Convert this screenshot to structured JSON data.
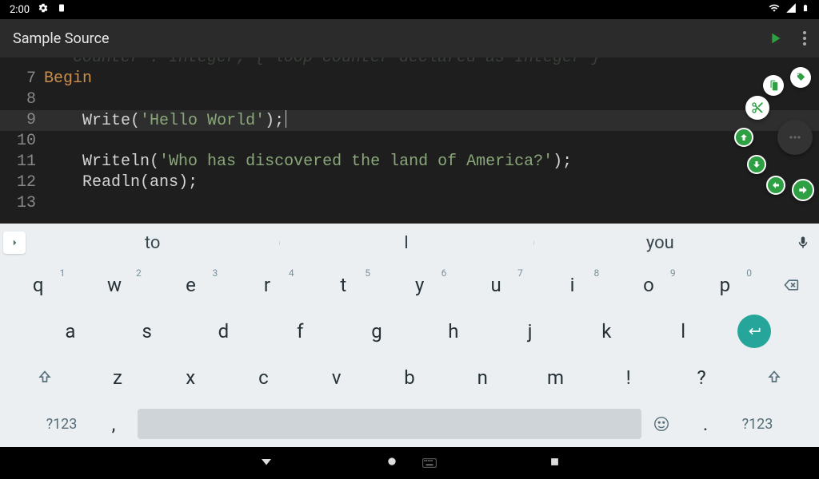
{
  "status": {
    "time": "2:00"
  },
  "app": {
    "title": "Sample Source"
  },
  "editor": {
    "visible_comment_fragment": "{ loop counter declared as Integer }",
    "lines": [
      {
        "n": "7",
        "kw": "Begin",
        "rest": ""
      },
      {
        "n": "8",
        "code": ""
      },
      {
        "n": "9",
        "fn": "Write",
        "open": "(",
        "str": "'Hello World'",
        "close": ");",
        "cursor": true
      },
      {
        "n": "10",
        "code": ""
      },
      {
        "n": "11",
        "fn": "Writeln",
        "open": "(",
        "str": "'Who has discovered the land of America?'",
        "close": ");"
      },
      {
        "n": "12",
        "fn": "Readln",
        "open": "(",
        "var": "ans",
        "close": ");"
      },
      {
        "n": "13",
        "code": ""
      }
    ]
  },
  "suggestions": {
    "s1": "to",
    "s2": "I",
    "s3": "you"
  },
  "keys": {
    "r1": [
      {
        "k": "q",
        "s": "1"
      },
      {
        "k": "w",
        "s": "2"
      },
      {
        "k": "e",
        "s": "3"
      },
      {
        "k": "r",
        "s": "4"
      },
      {
        "k": "t",
        "s": "5"
      },
      {
        "k": "y",
        "s": "6"
      },
      {
        "k": "u",
        "s": "7"
      },
      {
        "k": "i",
        "s": "8"
      },
      {
        "k": "o",
        "s": "9"
      },
      {
        "k": "p",
        "s": "0"
      }
    ],
    "r2": [
      "a",
      "s",
      "d",
      "f",
      "g",
      "h",
      "j",
      "k",
      "l"
    ],
    "r3": [
      "z",
      "x",
      "c",
      "v",
      "b",
      "n",
      "m",
      "!",
      "?"
    ],
    "sym": "?123",
    "comma": ",",
    "period": "."
  }
}
